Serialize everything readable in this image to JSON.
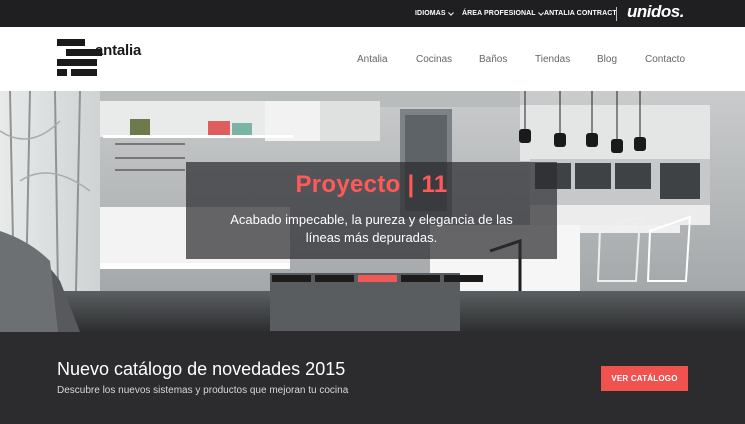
{
  "topbar": {
    "idiomas": "IDIOMAS",
    "area_profesional": "ÁREA PROFESIONAL",
    "contract": "ANTALIA CONTRACT",
    "brand": "unidos."
  },
  "header": {
    "logo_text": "antalia",
    "nav": [
      "Antalia",
      "Cocinas",
      "Baños",
      "Tiendas",
      "Blog",
      "Contacto"
    ]
  },
  "hero": {
    "title": "Proyecto | 11",
    "description": "Acabado impecable, la pureza y elegancia de las líneas más depuradas.",
    "slides": 5,
    "active_slide": 3
  },
  "catalog": {
    "title": "Nuevo catálogo de novedades 2015",
    "subtitle": "Descubre los nuevos sistemas y productos que mejoran tu cocina",
    "button": "VER CATÁLOGO"
  },
  "colors": {
    "accent": "#f0524f",
    "topbar_bg": "#1f1f21",
    "band_bg": "#2c2c2e"
  }
}
